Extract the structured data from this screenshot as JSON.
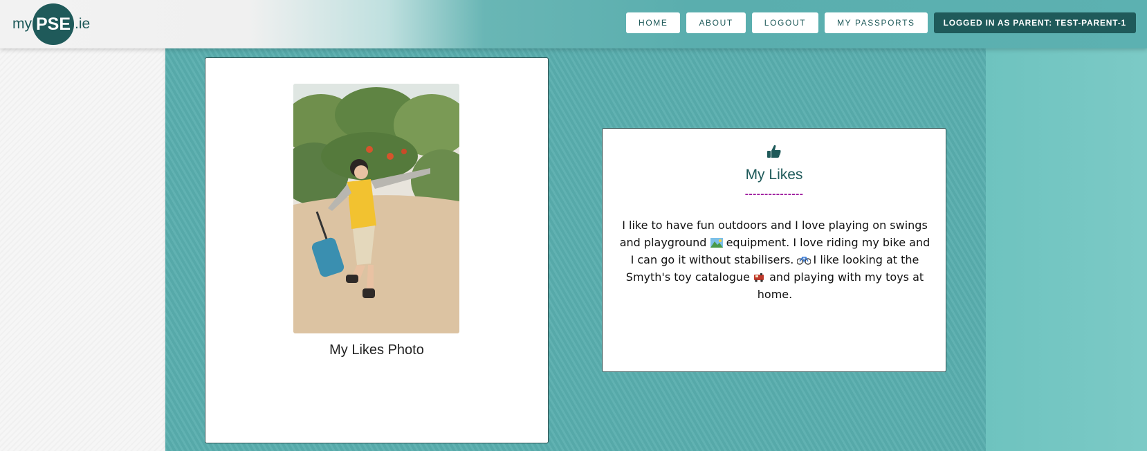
{
  "header": {
    "logo": {
      "prefix": "my",
      "center": "PSE",
      "suffix": ".ie"
    },
    "nav": [
      {
        "label": "HOME"
      },
      {
        "label": "ABOUT"
      },
      {
        "label": "LOGOUT"
      },
      {
        "label": "MY PASSPORTS"
      }
    ],
    "status_label": "LOGGED IN AS PARENT: TEST-PARENT-1"
  },
  "photo_card": {
    "caption": "My Likes Photo"
  },
  "likes_card": {
    "icon": "thumbs-up-icon",
    "title": "My Likes",
    "divider": "---------------",
    "text_1": "I like to have fun outdoors and I love playing on swings and playground ",
    "text_2": " equipment. I love riding my bike and I can go it without stabilisers. ",
    "text_3": " I like looking at the Smyth's toy catalogue ",
    "text_4": " and playing with my toys at home.",
    "emojis": [
      "playground-emoji",
      "bicycle-emoji",
      "train-emoji"
    ]
  },
  "colors": {
    "brand_dark": "#1f5a5a",
    "main_teal": "#59aeae",
    "divider_purple": "#a020a0"
  }
}
